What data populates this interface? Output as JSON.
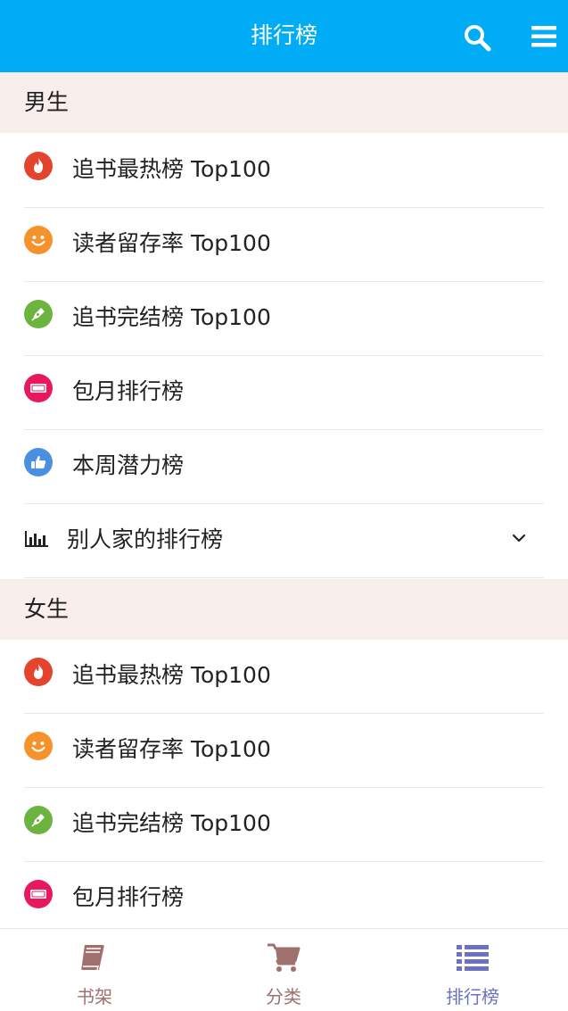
{
  "header": {
    "title": "排行榜",
    "search_icon": "search-icon",
    "menu_icon": "hamburger-menu-icon",
    "bg_color": "#00acf5"
  },
  "male": {
    "title": "男生",
    "items": [
      {
        "label": "追书最热榜 Top100",
        "icon": "flame-icon",
        "color": "#e4432d"
      },
      {
        "label": "读者留存率 Top100",
        "icon": "smiley-icon",
        "color": "#f6922b"
      },
      {
        "label": "追书完结榜 Top100",
        "icon": "pen-icon",
        "color": "#6db33f"
      },
      {
        "label": "包月排行榜",
        "icon": "ticket-icon",
        "color": "#e8185e"
      },
      {
        "label": "本周潜力榜",
        "icon": "thumbs-up-icon",
        "color": "#4a90e2"
      }
    ],
    "other": {
      "label": "别人家的排行榜",
      "icon": "bar-chart-icon",
      "chevron": "chevron-down-icon"
    }
  },
  "female": {
    "title": "女生",
    "items": [
      {
        "label": "追书最热榜 Top100",
        "icon": "flame-icon",
        "color": "#e4432d"
      },
      {
        "label": "读者留存率 Top100",
        "icon": "smiley-icon",
        "color": "#f6922b"
      },
      {
        "label": "追书完结榜 Top100",
        "icon": "pen-icon",
        "color": "#6db33f"
      },
      {
        "label": "包月排行榜",
        "icon": "ticket-icon",
        "color": "#e8185e"
      }
    ]
  },
  "bottom_nav": {
    "tabs": [
      {
        "label": "书架",
        "icon": "book-icon",
        "active": false
      },
      {
        "label": "分类",
        "icon": "cart-icon",
        "active": false
      },
      {
        "label": "排行榜",
        "icon": "list-icon",
        "active": true
      }
    ],
    "inactive_color": "#a0706f",
    "active_color": "#6b72c2"
  }
}
